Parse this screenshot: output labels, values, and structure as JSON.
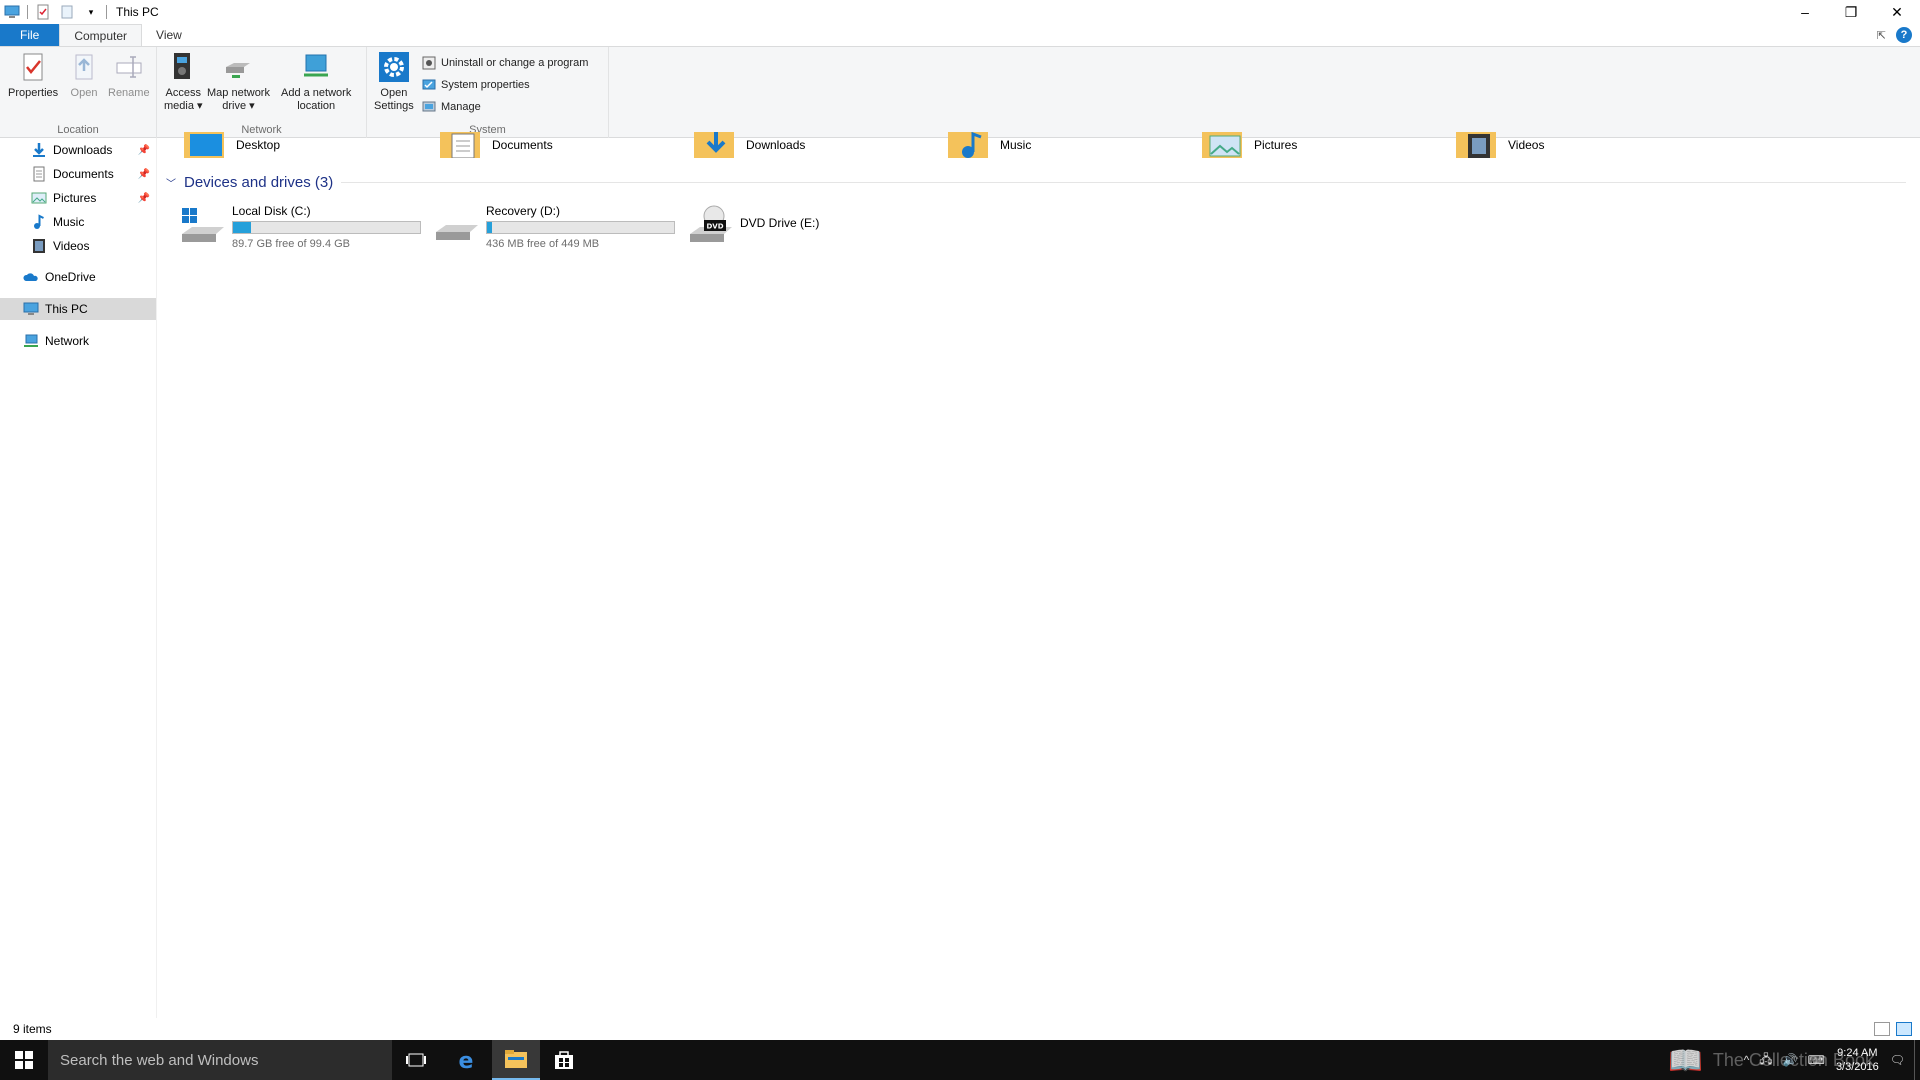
{
  "window": {
    "title": "This PC",
    "controls": {
      "minimize": "–",
      "restore": "❐",
      "close": "✕"
    }
  },
  "tabs": [
    {
      "label": "File"
    },
    {
      "label": "Computer"
    },
    {
      "label": "View"
    }
  ],
  "ribbon": {
    "location": {
      "label": "Location",
      "properties": "Properties",
      "open": "Open",
      "rename": "Rename"
    },
    "network": {
      "label": "Network",
      "access_media": [
        "Access",
        "media ▾"
      ],
      "map_network_drive": [
        "Map network",
        "drive ▾"
      ],
      "add_network_location": [
        "Add a network",
        "location"
      ]
    },
    "system": {
      "label": "System",
      "open_settings": [
        "Open",
        "Settings"
      ],
      "uninstall": "Uninstall or change a program",
      "system_properties": "System properties",
      "manage": "Manage"
    }
  },
  "nav": {
    "items": [
      {
        "label": "Downloads",
        "icon": "download-icon",
        "pinned": true
      },
      {
        "label": "Documents",
        "icon": "document-icon",
        "pinned": true
      },
      {
        "label": "Pictures",
        "icon": "pictures-icon",
        "pinned": true
      },
      {
        "label": "Music",
        "icon": "music-icon",
        "pinned": false
      },
      {
        "label": "Videos",
        "icon": "videos-icon",
        "pinned": false
      },
      {
        "label": "OneDrive",
        "icon": "onedrive-icon",
        "pinned": false
      },
      {
        "label": "This PC",
        "icon": "computer-icon",
        "pinned": false
      },
      {
        "label": "Network",
        "icon": "network-icon",
        "pinned": false
      }
    ]
  },
  "folders": [
    {
      "label": "Desktop"
    },
    {
      "label": "Documents"
    },
    {
      "label": "Downloads"
    },
    {
      "label": "Music"
    },
    {
      "label": "Pictures"
    },
    {
      "label": "Videos"
    }
  ],
  "devices": {
    "header": "Devices and drives (3)",
    "drives": [
      {
        "name": "Local Disk (C:)",
        "free": "89.7 GB free of 99.4 GB",
        "used_fraction": 0.098
      },
      {
        "name": "Recovery (D:)",
        "free": "436 MB free of 449 MB",
        "used_fraction": 0.029
      },
      {
        "name": "DVD Drive (E:)"
      }
    ]
  },
  "status": {
    "count": "9 items"
  },
  "taskbar": {
    "search_placeholder": "Search the web and Windows",
    "watermark": "The Collection Book",
    "time": "9:24 AM",
    "date": "3/3/2016"
  },
  "colors": {
    "accent": "#1979ca",
    "section_header": "#1e3287",
    "drive_fill": "#26a0da",
    "taskbar": "#101010"
  }
}
